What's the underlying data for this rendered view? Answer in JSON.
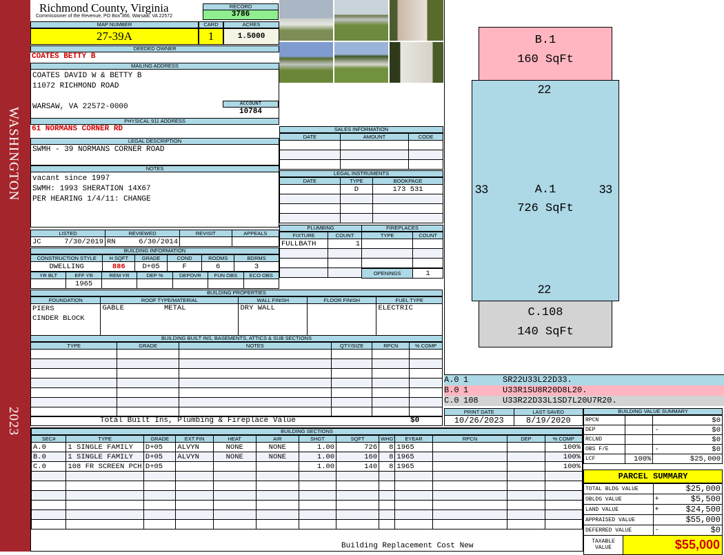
{
  "side": {
    "district": "WASHINGTON",
    "year": "2023"
  },
  "header": {
    "title": "Richmond County, Virginia",
    "subtitle": "Commissioner of the Revenue, PO Box 366, Warsaw, VA 22572",
    "record_label": "RECORD",
    "record": "3786"
  },
  "parcel": {
    "map_label": "MAP NUMBER",
    "map": "27-39A",
    "card_label": "CARD",
    "card": "1",
    "acres_label": "ACRES",
    "acres": "1.5000"
  },
  "owner": {
    "label": "DEEDED OWNER",
    "name": "COATES BETTY B"
  },
  "mailing": {
    "label": "MAILING ADDRESS",
    "lines": [
      "COATES DAVID W & BETTY B",
      "11072 RICHMOND ROAD",
      "WARSAW, VA 22572-0000"
    ],
    "account_label": "ACCOUNT",
    "account": "10784"
  },
  "physical": {
    "label": "PHYSICAL 911 ADDRESS",
    "address": "61 NORMANS CORNER RD"
  },
  "legal": {
    "label": "LEGAL DESCRIPTION",
    "text": "SWMH - 39 NORMANS CORNER ROAD"
  },
  "notes": {
    "label": "NOTES",
    "lines": [
      "vacant since 1997",
      "SWMH: 1993 SHERATION 14X67",
      "PER HEARING 1/4/11: CHANGE"
    ]
  },
  "listing": {
    "listed_label": "LISTED",
    "reviewed_label": "REVIEWED",
    "revisit_label": "REVISIT",
    "appeals_label": "APPEALS",
    "listed_by": "JC",
    "listed_date": "7/30/2019",
    "reviewed_by": "RN",
    "reviewed_date": "6/30/2014"
  },
  "building_info": {
    "label": "BUILDING INFORMATION",
    "h1": [
      "CONSTRUCTION STYLE",
      "H SQFT",
      "GRADE",
      "COND",
      "ROOMS",
      "BDRMS"
    ],
    "v1": [
      "DWELLING",
      "886",
      "D+05",
      "F",
      "6",
      "3"
    ],
    "h2": [
      "YR BLT",
      "EFF YR",
      "REM YR",
      "DEP %",
      "DEPOVR",
      "FUN OBS",
      "ECO OBS"
    ],
    "v2": [
      "",
      "1965",
      "",
      "",
      "",
      "",
      ""
    ]
  },
  "props": {
    "label": "BUILDING PROPERTIES",
    "h": [
      "FOUNDATION",
      "ROOF TYPE/MATERIAL",
      "WALL FINISH",
      "FLOOR FINISH",
      "FUEL TYPE"
    ],
    "foundation": [
      "PIERS",
      "CINDER BLOCK"
    ],
    "roof_type": "GABLE",
    "roof_material": "METAL",
    "wall": "DRY WALL",
    "floor": "",
    "fuel": "ELECTRIC"
  },
  "builtins": {
    "label": "BUILDING BUILT INS, BASEMENTS, ATTICS & SUB SECTIONS",
    "h": [
      "TYPE",
      "GRADE",
      "NOTES",
      "QTY/SIZE",
      "RPCN",
      "% COMP"
    ],
    "total_label": "Total Built Ins, Plumbing & Fireplace Value",
    "total": "$0"
  },
  "sales": {
    "label": "SALES INFORMATION",
    "h": [
      "DATE",
      "AMOUNT",
      "CODE"
    ]
  },
  "instruments": {
    "label": "LEGAL INSTRUMENTS",
    "h": [
      "DATE",
      "TYPE",
      "BOOKPAGE"
    ],
    "rows": [
      [
        "",
        "D",
        "173 531"
      ]
    ]
  },
  "plumbing": {
    "label": "PLUMBING",
    "h": [
      "FIXTURE",
      "COUNT"
    ],
    "rows": [
      [
        "FULLBATH",
        "1"
      ]
    ]
  },
  "fireplaces": {
    "label": "FIREPLACES",
    "h": [
      "TYPE",
      "COUNT"
    ],
    "openings_label": "OPENINGS",
    "openings": "1"
  },
  "sections": {
    "label": "BUILDING SECTIONS",
    "h": [
      "SEC#",
      "TYPE",
      "GRADE",
      "EXT FIN",
      "HEAT",
      "AIR",
      "SHGT",
      "SQFT",
      "WHGT",
      "EYEAR",
      "RPCN",
      "DEP",
      "% COMP"
    ],
    "rows": [
      [
        "A.0",
        "1 SINGLE FAMILY",
        "D+05",
        "ALVYN",
        "NONE",
        "NONE",
        "1.00",
        "726",
        "8",
        "1965",
        "",
        "",
        "100%"
      ],
      [
        "B.0",
        "1 SINGLE FAMILY",
        "D+05",
        "ALVYN",
        "NONE",
        "NONE",
        "1.00",
        "160",
        "8",
        "1965",
        "",
        "",
        "100%"
      ],
      [
        "C.0",
        "108 FR SCREEN PCH",
        "D+05",
        "",
        "",
        "",
        "1.00",
        "140",
        "8",
        "1965",
        "",
        "",
        "100%"
      ]
    ],
    "footer": "Building Replacement Cost New"
  },
  "sketch": {
    "areas": [
      {
        "id": "B.1",
        "sqft": "160 SqFt",
        "color": "#ffb6c1"
      },
      {
        "id": "A.1",
        "sqft": "726 SqFt",
        "color": "#add8e6",
        "dims": [
          "22",
          "33",
          "33",
          "22"
        ]
      },
      {
        "id": "C.108",
        "sqft": "140 SqFt",
        "color": "#d3d3d3"
      }
    ],
    "legend": [
      [
        "A.0",
        "1",
        "SR22U33L22D33."
      ],
      [
        "B.0",
        "1",
        "U33R1SU8R20D8L20."
      ],
      [
        "C.0",
        "108",
        "U33R22D33L1SD7L20U7R20."
      ]
    ]
  },
  "dates": {
    "print_label": "PRINT DATE",
    "print": "10/26/2023",
    "saved_label": "LAST SAVED",
    "saved": "8/19/2020"
  },
  "bvs": {
    "label": "BUILDING VALUE SUMMARY",
    "rows": [
      [
        "RPCN",
        "",
        "",
        "$0"
      ],
      [
        "DEP",
        "",
        "-",
        "$0"
      ],
      [
        "RCLND",
        "",
        "",
        "$0"
      ],
      [
        "OBS F/E",
        "",
        "-",
        "$0"
      ],
      [
        "LCF",
        "100%",
        "",
        "$25,000"
      ]
    ]
  },
  "summary": {
    "label": "PARCEL SUMMARY",
    "rows": [
      [
        "TOTAL BLDG VALUE",
        "",
        "$25,000"
      ],
      [
        "OBLDG VALUE",
        "+",
        "$5,500"
      ],
      [
        "LAND VALUE",
        "+",
        "$24,500"
      ],
      [
        "APPRAISED VALUE",
        "",
        "$55,000"
      ],
      [
        "DEFERRED VALUE",
        "-",
        "$0"
      ]
    ],
    "taxable_label": "TAXABLE VALUE",
    "taxable": "$55,000"
  }
}
